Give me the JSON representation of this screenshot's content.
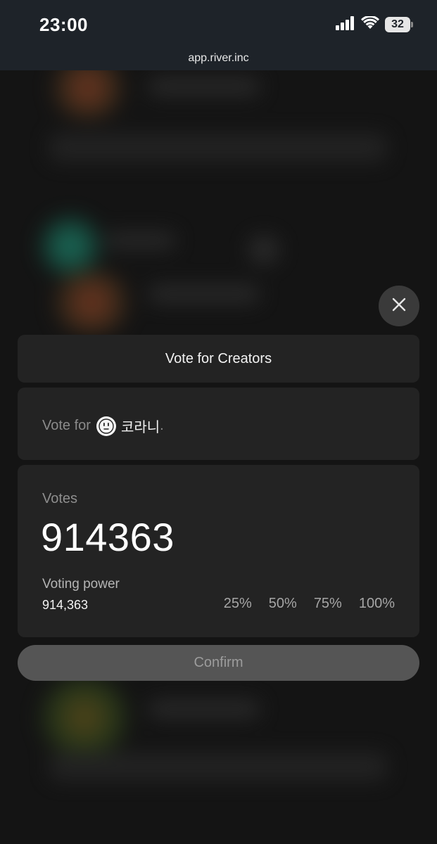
{
  "status_bar": {
    "time": "23:00",
    "battery": "32"
  },
  "browser": {
    "url": "app.river.inc"
  },
  "modal": {
    "title": "Vote for Creators",
    "vote_for_label": "Vote for",
    "creator_name": "코라니",
    "period": ".",
    "votes_label": "Votes",
    "votes_value": "914363",
    "voting_power_label": "Voting power",
    "voting_power_value": "914,363",
    "percent_options": [
      "25%",
      "50%",
      "75%",
      "100%"
    ],
    "confirm_label": "Confirm"
  },
  "icons": {
    "close": "close-icon",
    "signal": "cellular-signal-icon",
    "wifi": "wifi-icon",
    "battery": "battery-icon",
    "avatar": "creator-avatar-icon"
  }
}
